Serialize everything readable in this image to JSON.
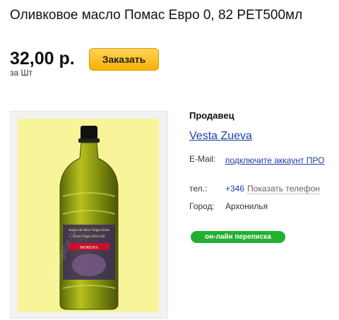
{
  "product": {
    "title": "Оливковое масло Помас Евро 0, 82 PET500мл",
    "price": "32,00 р.",
    "unit": "за Шт",
    "order_label": "Заказать",
    "photo_label_lines": [
      "Aceite de Oliva Virgen Extra",
      "Extra Virgin Olive Oil"
    ],
    "photo_brand": "MORENA",
    "photo_watermark": "aggregator.ru",
    "photo_bg_color": "#f8f49a"
  },
  "seller": {
    "heading": "Продавец",
    "name": "Vesta Zueva",
    "email_label": "E-Mail:",
    "email_value": "подключите аккаунт ПРО",
    "phone_label": "тел.:",
    "phone_prefix": "+346",
    "phone_show": "Показать телефон",
    "city_label": "Город:",
    "city_value": "Архонилья",
    "chat_label": "он-лайн переписка",
    "link_color": "#1a3fa6",
    "chat_color": "#22b030"
  }
}
